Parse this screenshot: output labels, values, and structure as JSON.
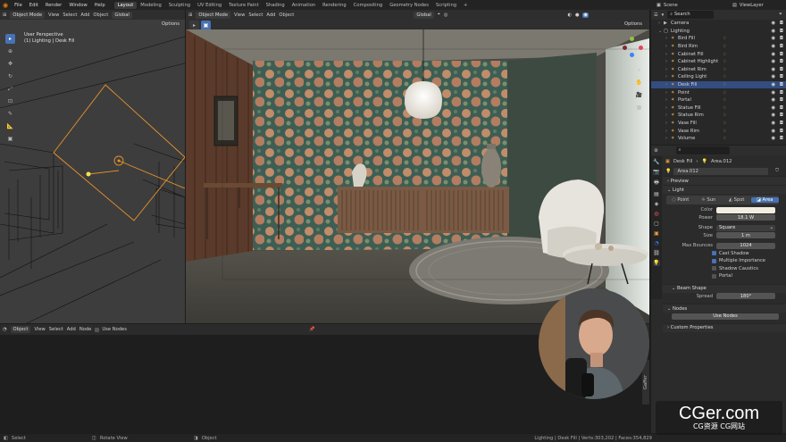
{
  "topbar": {
    "menu": [
      "File",
      "Edit",
      "Render",
      "Window",
      "Help"
    ],
    "tabs": [
      "Layout",
      "Modeling",
      "Sculpting",
      "UV Editing",
      "Texture Paint",
      "Shading",
      "Animation",
      "Rendering",
      "Compositing",
      "Geometry Nodes",
      "Scripting"
    ],
    "active_tab": "Layout",
    "scene": "Scene",
    "view_layer": "ViewLayer"
  },
  "left_viewport": {
    "mode": "Object Mode",
    "menus": [
      "View",
      "Select",
      "Add",
      "Object"
    ],
    "orientation": "Global",
    "options": "Options",
    "info_line1": "User Perspective",
    "info_line2": "(1) Lighting | Desk Fill"
  },
  "main_viewport": {
    "mode": "Object Mode",
    "menus": [
      "View",
      "Select",
      "Add",
      "Object"
    ],
    "orientation": "Global",
    "options": "Options"
  },
  "node_editor": {
    "type": "Object",
    "menus": [
      "View",
      "Select",
      "Add",
      "Node"
    ],
    "use_nodes": "Use Nodes",
    "side_tab": "Gaffer"
  },
  "outliner": {
    "search_placeholder": "Search",
    "items": [
      {
        "name": "Camera",
        "indent": 1,
        "selected": false
      },
      {
        "name": "Lighting",
        "indent": 1,
        "selected": false
      },
      {
        "name": "Bird Fill",
        "indent": 2,
        "selected": false
      },
      {
        "name": "Bird Rim",
        "indent": 2,
        "selected": false
      },
      {
        "name": "Cabinet Fill",
        "indent": 2,
        "selected": false
      },
      {
        "name": "Cabinet Highlight",
        "indent": 2,
        "selected": false
      },
      {
        "name": "Cabinet Rim",
        "indent": 2,
        "selected": false
      },
      {
        "name": "Ceiling Light",
        "indent": 2,
        "selected": false
      },
      {
        "name": "Desk Fill",
        "indent": 2,
        "selected": true
      },
      {
        "name": "Point",
        "indent": 2,
        "selected": false
      },
      {
        "name": "Portal",
        "indent": 2,
        "selected": false
      },
      {
        "name": "Statue Fill",
        "indent": 2,
        "selected": false
      },
      {
        "name": "Statue Rim",
        "indent": 2,
        "selected": false
      },
      {
        "name": "Vase Fill",
        "indent": 2,
        "selected": false
      },
      {
        "name": "Vase Rim",
        "indent": 2,
        "selected": false
      },
      {
        "name": "Volume",
        "indent": 2,
        "selected": false
      }
    ]
  },
  "properties": {
    "object_name": "Desk Fill",
    "data_name": "Area.012",
    "datablock_field": "Area.012",
    "preview_label": "Preview",
    "light_label": "Light",
    "light_types": [
      "Point",
      "Sun",
      "Spot",
      "Area"
    ],
    "active_light_type": "Area",
    "color_label": "Color",
    "power_label": "Power",
    "power_value": "18.1 W",
    "shape_label": "Shape",
    "shape_value": "Square",
    "size_label": "Size",
    "size_value": "1 m",
    "max_bounces_label": "Max Bounces",
    "max_bounces_value": "1024",
    "checkboxes": [
      {
        "label": "Cast Shadow",
        "checked": true
      },
      {
        "label": "Multiple Importance",
        "checked": true
      },
      {
        "label": "Shadow Caustics",
        "checked": false
      },
      {
        "label": "Portal",
        "checked": false
      }
    ],
    "beam_shape_label": "Beam Shape",
    "spread_label": "Spread",
    "spread_value": "180°",
    "nodes_label": "Nodes",
    "use_nodes_button": "Use Nodes",
    "custom_props_label": "Custom Properties"
  },
  "statusbar": {
    "select": "Select",
    "rotate": "Rotate View",
    "object": "Object",
    "stats": "Lighting | Desk Fill | Verts:303,202 | Faces:354,829"
  },
  "watermark": {
    "text": "CGer.com",
    "subtext": "CG资源 CG网站"
  },
  "colors": {
    "accent": "#4772b3",
    "selection": "#334d80",
    "light_color": "#f2ede0"
  }
}
